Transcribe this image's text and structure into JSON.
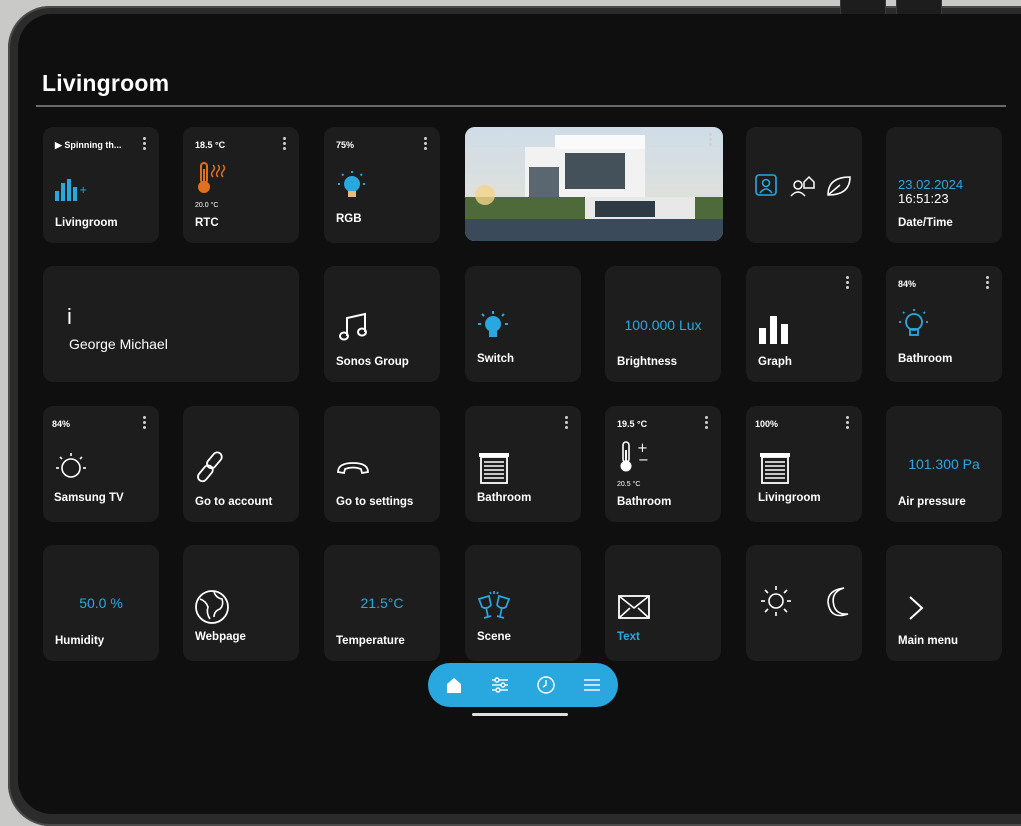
{
  "room": {
    "title": "Livingroom"
  },
  "colors": {
    "accent": "#29a8e0",
    "tile": "#1d1d1d",
    "background": "#0f0f0f",
    "thermo": "#e07020"
  },
  "tiles": {
    "audio": {
      "top": "▶ Spinning th...",
      "label": "Livingroom",
      "icon": "audio-bars-icon"
    },
    "rtc": {
      "top": "18.5 °C",
      "sub": "20.0 °C",
      "label": "RTC",
      "icon": "heating-thermometer-icon"
    },
    "rgb": {
      "top": "75%",
      "label": "RGB",
      "icon": "color-bulb-icon"
    },
    "image": {
      "icon": "house-photo"
    },
    "scenes3": {
      "icons": [
        "home-icon",
        "user-home-icon",
        "leaf-icon"
      ]
    },
    "datetime": {
      "date": "23.02.2024",
      "time": "16:51:23",
      "label": "Date/Time"
    },
    "info": {
      "glyph": "i",
      "text": "George Michael"
    },
    "sonos": {
      "label": "Sonos Group",
      "icon": "music-note-icon"
    },
    "switch": {
      "label": "Switch",
      "icon": "light-bulb-icon"
    },
    "brightness": {
      "value": "100.000 Lux",
      "label": "Brightness"
    },
    "graph": {
      "label": "Graph",
      "icon": "bar-chart-icon"
    },
    "bathroom_light": {
      "top": "84%",
      "label": "Bathroom",
      "icon": "light-bulb-icon"
    },
    "samsung": {
      "top": "84%",
      "label": "Samsung TV",
      "icon": "dimmer-icon"
    },
    "account": {
      "label": "Go to account",
      "icon": "link-icon"
    },
    "settings": {
      "label": "Go to settings",
      "icon": "phone-hangup-icon"
    },
    "bathroom_blind": {
      "label": "Bathroom",
      "icon": "blind-icon"
    },
    "bathroom_thermo": {
      "top": "19.5 °C",
      "sub": "20.5 °C",
      "label": "Bathroom",
      "icon": "thermostat-icon"
    },
    "livingroom_blind": {
      "top": "100%",
      "label": "Livingroom",
      "icon": "blind-icon"
    },
    "pressure": {
      "value": "101.300 Pa",
      "label": "Air pressure"
    },
    "humidity": {
      "value": "50.0 %",
      "label": "Humidity"
    },
    "webpage": {
      "label": "Webpage",
      "icon": "globe-icon"
    },
    "temperature": {
      "value": "21.5°C",
      "label": "Temperature"
    },
    "scene": {
      "label": "Scene",
      "icon": "cheers-glasses-icon"
    },
    "text": {
      "label": "Text",
      "icon": "envelope-icon"
    },
    "daynight": {
      "icons": [
        "sun-icon",
        "moon-icon"
      ]
    },
    "mainmenu": {
      "label": "Main menu",
      "icon": "chevron-right-icon"
    }
  },
  "dock": {
    "items": [
      "home-icon",
      "sliders-icon",
      "clock-icon",
      "menu-icon"
    ]
  }
}
